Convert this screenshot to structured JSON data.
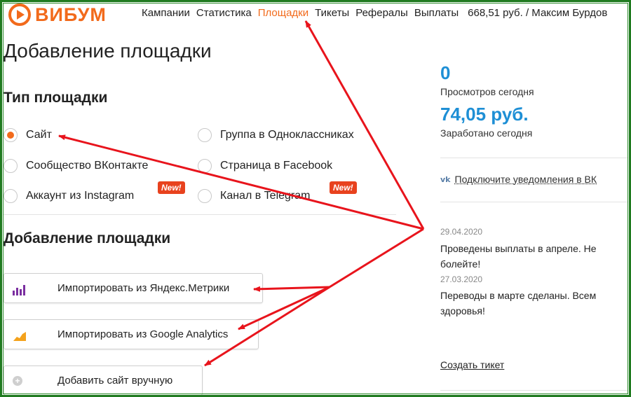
{
  "header": {
    "logo_text": "ВИБУМ",
    "nav": [
      {
        "label": "Кампании",
        "active": false
      },
      {
        "label": "Статистика",
        "active": false
      },
      {
        "label": "Площадки",
        "active": true
      },
      {
        "label": "Тикеты",
        "active": false
      },
      {
        "label": "Рефералы",
        "active": false
      },
      {
        "label": "Выплаты",
        "active": false
      }
    ],
    "balance": "668,51 руб. / Максим Бурдов"
  },
  "main": {
    "title": "Добавление площадки",
    "type_section_title": "Тип площадки",
    "types": [
      {
        "label": "Сайт",
        "checked": true
      },
      {
        "label": "Группа в Одноклассниках",
        "checked": false
      },
      {
        "label": "Сообщество ВКонтакте",
        "checked": false
      },
      {
        "label": "Страница в Facebook",
        "checked": false
      },
      {
        "label": "Аккаунт из Instagram",
        "checked": false,
        "badge": "New!"
      },
      {
        "label": "Канал в Telegram",
        "checked": false,
        "badge": "New!"
      }
    ],
    "add_section_title": "Добавление площадки",
    "buttons": [
      {
        "label": "Импортировать из Яндекс.Метрики",
        "icon": "bar-chart-icon"
      },
      {
        "label": "Импортировать из Google Analytics",
        "icon": "area-chart-icon"
      },
      {
        "label": "Добавить сайт вручную",
        "icon": "plus-circle-icon"
      }
    ]
  },
  "sidebar": {
    "views_value": "0",
    "views_label": "Просмотров сегодня",
    "earned_value": "74,05 руб.",
    "earned_label": "Заработано сегодня",
    "vk_icon": "vk-icon",
    "vk_label": "Подключите уведомления в ВК",
    "news": [
      {
        "date": "29.04.2020",
        "text": "Проведены выплаты в апреле. Не болейте!"
      },
      {
        "date": "27.03.2020",
        "text": "Переводы в марте сделаны. Всем здоровья!"
      }
    ],
    "ticket_label": "Создать тикет"
  },
  "colors": {
    "accent": "#f26a1b",
    "stat_blue": "#1e8fd5",
    "arrow_red": "#e8141c",
    "badge_red": "#e8421e",
    "frame_green": "#1f7a1f"
  }
}
